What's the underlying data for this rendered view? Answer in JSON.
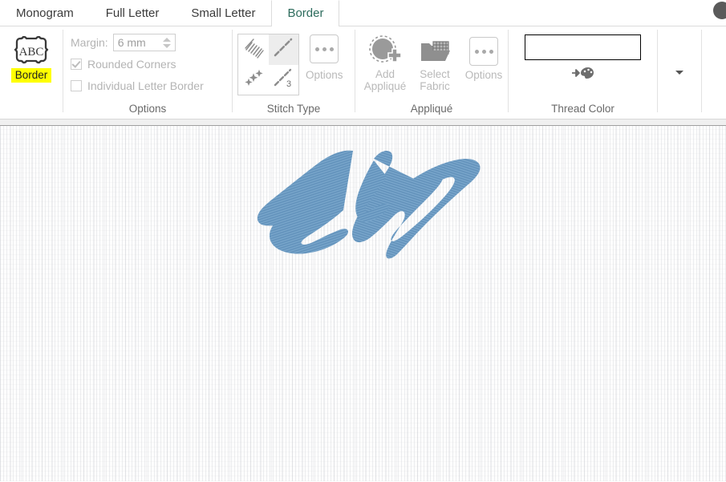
{
  "window": {
    "titlebar_icon": "circle-icon"
  },
  "tabs": [
    {
      "label": "Monogram",
      "active": false
    },
    {
      "label": "Full Letter",
      "active": false
    },
    {
      "label": "Small Letter",
      "active": false
    },
    {
      "label": "Border",
      "active": true
    }
  ],
  "ribbon": {
    "border_button": {
      "label": "Border",
      "icon": "abc-border-icon",
      "highlight_color": "#ffff00"
    },
    "options_group": {
      "label": "Options",
      "margin_label": "Margin:",
      "margin_value": "6 mm",
      "rounded_corners_label": "Rounded Corners",
      "rounded_corners_checked": true,
      "individual_letter_border_label": "Individual Letter Border",
      "individual_letter_border_checked": false
    },
    "stitch_type_group": {
      "label": "Stitch Type",
      "items": [
        {
          "name": "satin-stitch-icon",
          "selected": false
        },
        {
          "name": "running-stitch-icon",
          "selected": true
        },
        {
          "name": "motif-stitch-icon",
          "selected": false
        },
        {
          "name": "triple-stitch-icon",
          "selected": false
        }
      ],
      "options_label": "Options"
    },
    "applique_group": {
      "label": "Appliqué",
      "add_applique_label_line1": "Add",
      "add_applique_label_line2": "Appliqué",
      "select_fabric_label_line1": "Select",
      "select_fabric_label_line2": "Fabric",
      "options_label": "Options"
    },
    "thread_color_group": {
      "label": "Thread Color",
      "swatch_color": "#ffffff",
      "palette_icon": "arrow-to-palette-icon"
    },
    "more_dropdown_icon": "chevron-down-icon"
  },
  "canvas": {
    "background_color": "#fdfdfd",
    "design": {
      "name": "monogram-embroidery-ED",
      "thread_color": "#6d9cc4",
      "thread_color_dark": "#5d8cb5",
      "thread_color_light": "#84aed1"
    }
  }
}
